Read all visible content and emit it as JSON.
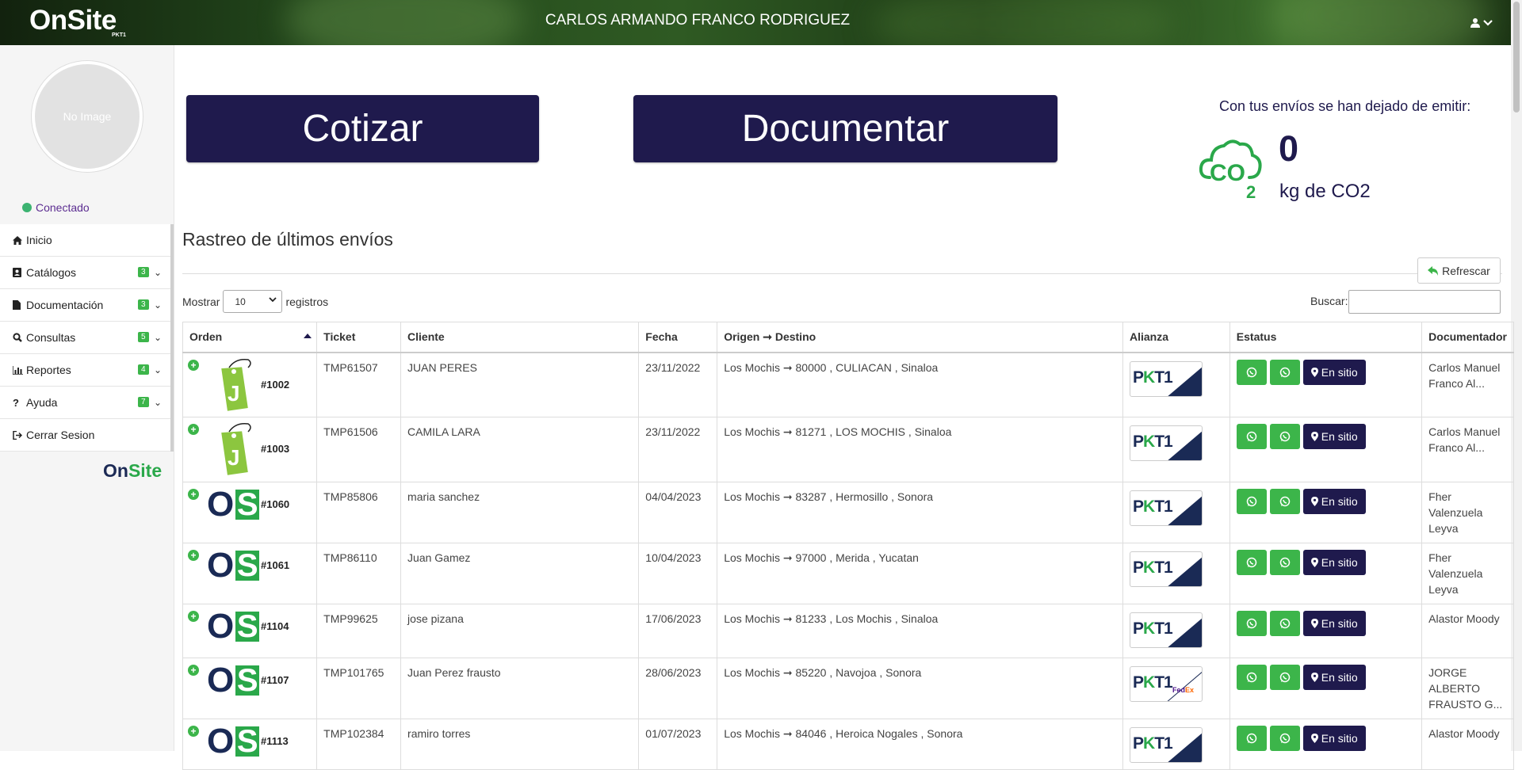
{
  "header": {
    "logo": "OnSite",
    "logo_sub": "PKT1",
    "user_name": "CARLOS ARMANDO FRANCO RODRIGUEZ",
    "user_icon": "user-icon"
  },
  "sidebar": {
    "avatar_text": "No Image",
    "status": "Conectado",
    "items": [
      {
        "label": "Inicio",
        "icon": "home-icon",
        "badge": ""
      },
      {
        "label": "Catálogos",
        "icon": "contact-book-icon",
        "badge": "3"
      },
      {
        "label": "Documentación",
        "icon": "file-icon",
        "badge": "3"
      },
      {
        "label": "Consultas",
        "icon": "search-icon",
        "badge": "5"
      },
      {
        "label": "Reportes",
        "icon": "bar-chart-icon",
        "badge": "4"
      },
      {
        "label": "Ayuda",
        "icon": "question-icon",
        "badge": "7"
      },
      {
        "label": "Cerrar Sesion",
        "icon": "sign-out-icon",
        "badge": ""
      }
    ],
    "footer_logo_on": "On",
    "footer_logo_site": "Site"
  },
  "actions": {
    "cotizar": "Cotizar",
    "documentar": "Documentar"
  },
  "co2": {
    "title": "Con tus envíos se han dejado de emitir:",
    "value": "0",
    "unit": "kg de CO2",
    "icon": "co2-cloud-icon"
  },
  "tracking": {
    "title": "Rastreo de últimos envíos",
    "refresh": "Refrescar",
    "show_label": "Mostrar",
    "show_value": "10",
    "records_label": "registros",
    "search_label": "Buscar:",
    "columns": [
      "Orden",
      "Ticket",
      "Cliente",
      "Fecha",
      "Origen ➞ Destino",
      "Alianza",
      "Estatus",
      "Documentador"
    ],
    "status_label": "En sitio",
    "rows": [
      {
        "order": "#1002",
        "logo": "tag",
        "ticket": "TMP61507",
        "client": "JUAN PERES",
        "date": "23/11/2022",
        "route": "Los Mochis ➞ 80000 , CULIACAN , Sinaloa",
        "alliance": "pkt1",
        "doc": "Carlos Manuel Franco Al..."
      },
      {
        "order": "#1003",
        "logo": "tag",
        "ticket": "TMP61506",
        "client": "CAMILA LARA",
        "date": "23/11/2022",
        "route": "Los Mochis ➞ 81271 , LOS MOCHIS , Sinaloa",
        "alliance": "pkt1",
        "doc": "Carlos Manuel Franco Al..."
      },
      {
        "order": "#1060",
        "logo": "os",
        "ticket": "TMP85806",
        "client": "maria sanchez",
        "date": "04/04/2023",
        "route": "Los Mochis ➞ 83287 , Hermosillo , Sonora",
        "alliance": "pkt1",
        "doc": "Fher Valenzuela Leyva"
      },
      {
        "order": "#1061",
        "logo": "os",
        "ticket": "TMP86110",
        "client": "Juan Gamez",
        "date": "10/04/2023",
        "route": "Los Mochis ➞ 97000 , Merida , Yucatan",
        "alliance": "pkt1",
        "doc": "Fher Valenzuela Leyva"
      },
      {
        "order": "#1104",
        "logo": "os",
        "ticket": "TMP99625",
        "client": "jose pizana",
        "date": "17/06/2023",
        "route": "Los Mochis ➞ 81233 , Los Mochis , Sinaloa",
        "alliance": "pkt1",
        "doc": "Alastor Moody"
      },
      {
        "order": "#1107",
        "logo": "os",
        "ticket": "TMP101765",
        "client": "Juan Perez frausto",
        "date": "28/06/2023",
        "route": "Los Mochis ➞ 85220 , Navojoa , Sonora",
        "alliance": "pkt1-fedex",
        "doc": "JORGE ALBERTO FRAUSTO G..."
      },
      {
        "order": "#1113",
        "logo": "os",
        "ticket": "TMP102384",
        "client": "ramiro torres",
        "date": "01/07/2023",
        "route": "Los Mochis ➞ 84046 , Heroica Nogales , Sonora",
        "alliance": "pkt1",
        "doc": "Alastor Moody"
      }
    ],
    "fedex_fe": "Fed",
    "fedex_ex": "Ex"
  },
  "colors": {
    "primary": "#1f1a4d",
    "green": "#3cb54a",
    "status_dot": "#3cb371"
  }
}
